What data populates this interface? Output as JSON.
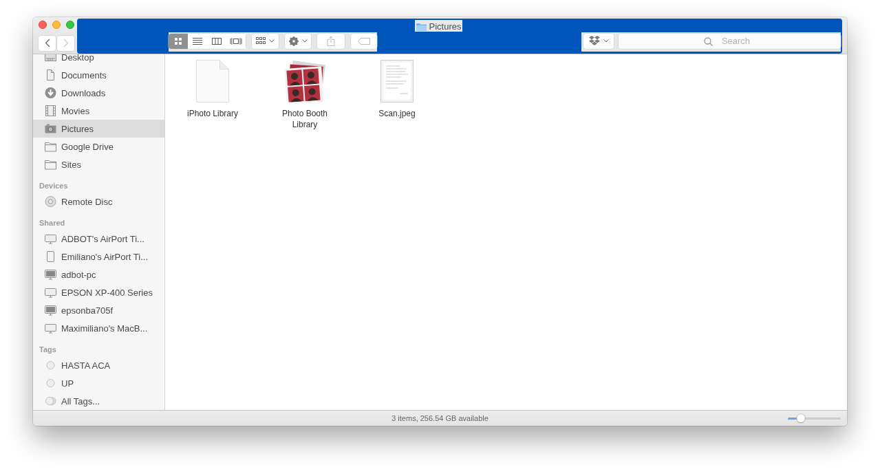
{
  "window": {
    "title": "Pictures"
  },
  "toolbar": {
    "back": {
      "disabled": false
    },
    "forward": {
      "disabled": true
    },
    "view_modes": [
      {
        "kind": "icons",
        "selected": true
      },
      {
        "kind": "list",
        "selected": false
      },
      {
        "kind": "columns",
        "selected": false
      },
      {
        "kind": "coverflow",
        "selected": false
      }
    ],
    "search": {
      "placeholder": "Search"
    }
  },
  "sidebar": {
    "sections": [
      {
        "items": [
          {
            "label": "Desktop",
            "kind": "desktop",
            "selected": false
          },
          {
            "label": "Documents",
            "kind": "document",
            "selected": false
          },
          {
            "label": "Downloads",
            "kind": "download",
            "selected": false
          },
          {
            "label": "Movies",
            "kind": "film",
            "selected": false
          },
          {
            "label": "Pictures",
            "kind": "camera",
            "selected": true
          },
          {
            "label": "Google Drive",
            "kind": "folder",
            "selected": false
          },
          {
            "label": "Sites",
            "kind": "folder",
            "selected": false
          }
        ]
      },
      {
        "heading": "Devices",
        "items": [
          {
            "label": "Remote Disc",
            "kind": "disc",
            "selected": false
          }
        ]
      },
      {
        "heading": "Shared",
        "items": [
          {
            "label": "ADBOT's AirPort Ti...",
            "kind": "monitor",
            "selected": false
          },
          {
            "label": "Emiliano's AirPort Ti...",
            "kind": "phone",
            "selected": false
          },
          {
            "label": "adbot-pc",
            "kind": "pc",
            "selected": false
          },
          {
            "label": "EPSON XP-400 Series",
            "kind": "monitor",
            "selected": false
          },
          {
            "label": "epsonba705f",
            "kind": "pc",
            "selected": false
          },
          {
            "label": "Maximiliano's MacB...",
            "kind": "monitor",
            "selected": false
          }
        ]
      },
      {
        "heading": "Tags",
        "items": [
          {
            "label": "HASTA ACA",
            "kind": "tag",
            "selected": false
          },
          {
            "label": "UP",
            "kind": "tag",
            "selected": false
          },
          {
            "label": "All Tags...",
            "kind": "all-tags",
            "selected": false
          }
        ]
      }
    ]
  },
  "files": [
    {
      "name": "iPhoto Library",
      "kind": "blank"
    },
    {
      "name": "Photo Booth Library",
      "kind": "photos"
    },
    {
      "name": "Scan.jpeg",
      "kind": "scan"
    }
  ],
  "status_bar": {
    "text": "3 items, 256.54 GB available",
    "zoom": {
      "level": 0.25
    }
  }
}
